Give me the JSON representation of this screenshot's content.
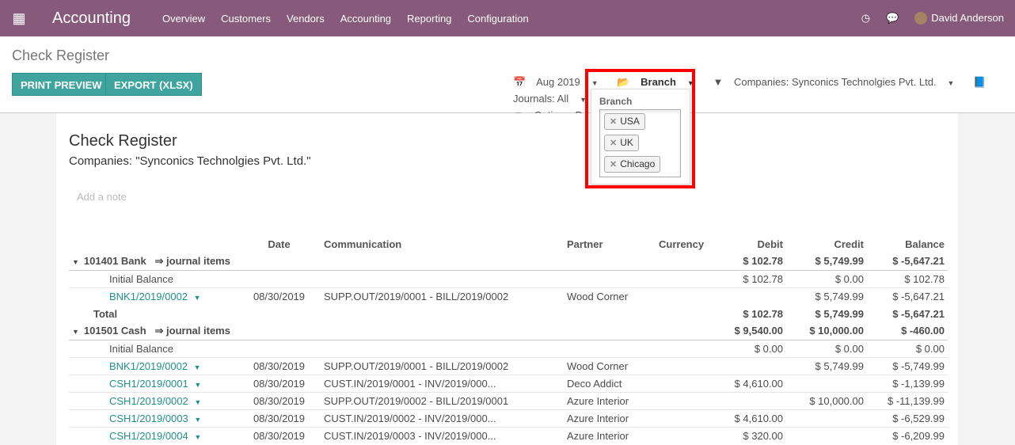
{
  "nav": {
    "app": "Accounting",
    "menu": [
      "Overview",
      "Customers",
      "Vendors",
      "Accounting",
      "Reporting",
      "Configuration"
    ],
    "user": "David Anderson"
  },
  "cp": {
    "title": "Check Register",
    "print": "PRINT PREVIEW",
    "export": "EXPORT (XLSX)",
    "date": "Aug 2019",
    "branch": "Branch",
    "companies": "Companies: Synconics Technolgies Pvt. Ltd.",
    "journals": "Journals: All",
    "options": "Options: Poste"
  },
  "dropdown": {
    "label": "Branch",
    "tags": [
      "USA",
      "UK",
      "Chicago"
    ]
  },
  "report": {
    "title": "Check Register",
    "companies": "Companies: \"Synconics Technolgies Pvt. Ltd.\"",
    "note": "Add a note",
    "headers": [
      "",
      "Date",
      "Communication",
      "Partner",
      "Currency",
      "Debit",
      "Credit",
      "Balance"
    ],
    "rows": [
      {
        "type": "grp",
        "name": "101401 Bank",
        "link": "⇒ journal items",
        "debit": "$ 102.78",
        "credit": "$ 5,749.99",
        "balance": "$ -5,647.21"
      },
      {
        "type": "init",
        "name": "Initial Balance",
        "debit": "$ 102.78",
        "credit": "$ 0.00",
        "balance": "$ 102.78"
      },
      {
        "type": "line",
        "name": "BNK1/2019/0002",
        "date": "08/30/2019",
        "comm": "SUPP.OUT/2019/0001 - BILL/2019/0002",
        "partner": "Wood Corner",
        "debit": "",
        "credit": "$ 5,749.99",
        "balance": "$ -5,647.21"
      },
      {
        "type": "tot",
        "name": "Total",
        "debit": "$ 102.78",
        "credit": "$ 5,749.99",
        "balance": "$ -5,647.21"
      },
      {
        "type": "grp",
        "name": "101501 Cash",
        "link": "⇒ journal items",
        "debit": "$ 9,540.00",
        "credit": "$ 10,000.00",
        "balance": "$ -460.00"
      },
      {
        "type": "init",
        "name": "Initial Balance",
        "debit": "$ 0.00",
        "credit": "$ 0.00",
        "balance": "$ 0.00"
      },
      {
        "type": "line",
        "name": "BNK1/2019/0002",
        "date": "08/30/2019",
        "comm": "SUPP.OUT/2019/0001 - BILL/2019/0002",
        "partner": "Wood Corner",
        "debit": "",
        "credit": "$ 5,749.99",
        "balance": "$ -5,749.99"
      },
      {
        "type": "line",
        "name": "CSH1/2019/0001",
        "date": "08/30/2019",
        "comm": "CUST.IN/2019/0001 - INV/2019/000...",
        "partner": "Deco Addict",
        "debit": "$ 4,610.00",
        "credit": "",
        "balance": "$ -1,139.99"
      },
      {
        "type": "line",
        "name": "CSH1/2019/0002",
        "date": "08/30/2019",
        "comm": "SUPP.OUT/2019/0002 - BILL/2019/0001",
        "partner": "Azure Interior",
        "debit": "",
        "credit": "$ 10,000.00",
        "balance": "$ -11,139.99"
      },
      {
        "type": "line",
        "name": "CSH1/2019/0003",
        "date": "08/30/2019",
        "comm": "CUST.IN/2019/0002 - INV/2019/000...",
        "partner": "Azure Interior",
        "debit": "$ 4,610.00",
        "credit": "",
        "balance": "$ -6,529.99"
      },
      {
        "type": "line",
        "name": "CSH1/2019/0004",
        "date": "08/30/2019",
        "comm": "CUST.IN/2019/0003 - INV/2019/000...",
        "partner": "Azure Interior",
        "debit": "$ 320.00",
        "credit": "",
        "balance": "$ -6,209.99"
      }
    ]
  }
}
